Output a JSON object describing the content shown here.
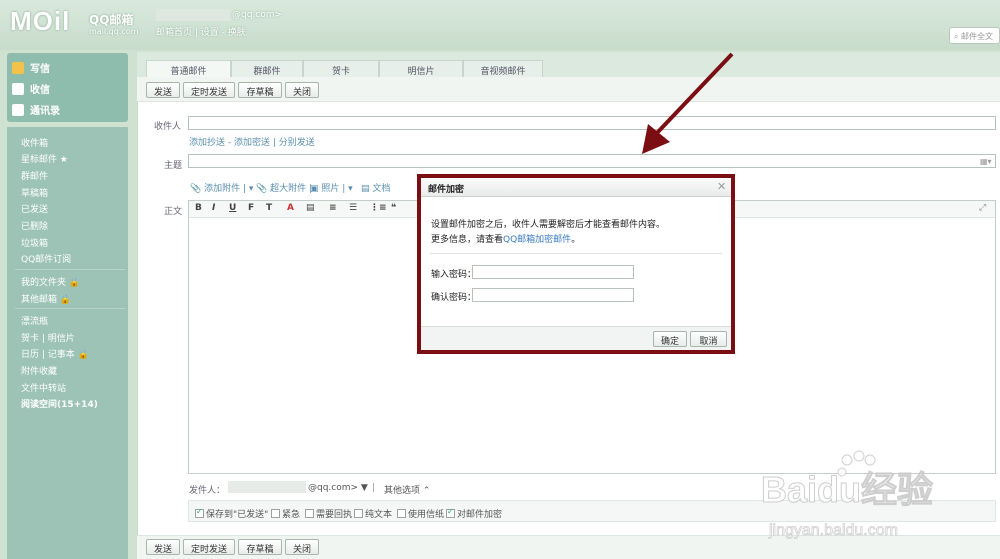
{
  "header": {
    "logo_mail": "MOil",
    "logo_brand": "QQ邮箱",
    "logo_url": "mail.qq.com",
    "account_domain": "@qq.com>",
    "links": "邮箱首页 | 设置 - 换肤",
    "search_placeholder": "邮件全文"
  },
  "sidebar": {
    "main": [
      {
        "label": "写信",
        "icon": "pencil-icon",
        "color": "#f3c24a"
      },
      {
        "label": "收信",
        "icon": "inbox-down-icon",
        "color": "#ffffff"
      },
      {
        "label": "通讯录",
        "icon": "contacts-icon",
        "color": "#ffffff"
      }
    ],
    "group1": [
      "收件箱",
      "星标邮件 ★",
      "群邮件",
      "草稿箱",
      "已发送",
      "已删除",
      "垃圾箱",
      "QQ邮件订阅"
    ],
    "group2": [
      "我的文件夹 🔒",
      "其他邮箱 🔒"
    ],
    "group3": [
      "漂流瓶",
      "贺卡 | 明信片",
      "日历 | 记事本 🔒",
      "附件收藏",
      "文件中转站",
      "阅读空间(15+14)"
    ]
  },
  "tabs": [
    "普通邮件",
    "群邮件",
    "贺卡",
    "明信片",
    "音视频邮件"
  ],
  "toolbar": {
    "send": "发送",
    "timed_send": "定时发送",
    "save_draft": "存草稿",
    "close": "关闭"
  },
  "compose": {
    "to_label": "收件人",
    "cc_links": "添加抄送 - 添加密送 | 分别发送",
    "subject_label": "主题",
    "attach_add": "添加附件",
    "attach_big": "超大附件",
    "attach_photo": "照片",
    "attach_doc": "文档",
    "body_label": "正文",
    "editor_tools": [
      "B",
      "I",
      "U",
      "F",
      "T",
      "A",
      "▤",
      "≡",
      "☰",
      "⋮≡",
      "❝"
    ],
    "sender_label": "发件人：",
    "sender_domain": "@qq.com> ▼",
    "other_options": "其他选项 ⌃"
  },
  "options": [
    {
      "label": "保存到\"已发送\"",
      "checked": true
    },
    {
      "label": "紧急",
      "checked": false
    },
    {
      "label": "需要回执",
      "checked": false
    },
    {
      "label": "纯文本",
      "checked": false
    },
    {
      "label": "使用信纸",
      "checked": false
    },
    {
      "label": "对邮件加密",
      "checked": true
    }
  ],
  "dialog": {
    "title": "邮件加密",
    "line1": "设置邮件加密之后，收件人需要解密后才能查看邮件内容。",
    "line2_prefix": "更多信息，请查看",
    "line2_link": "QQ邮箱加密邮件",
    "line2_suffix": "。",
    "pwd_label": "输入密码：",
    "confirm_label": "确认密码：",
    "ok": "确定",
    "cancel": "取消"
  },
  "watermark": {
    "brand": "Baidu经验",
    "url": "jingyan.baidu.com"
  },
  "colors": {
    "accent_red": "#7a0e12",
    "sidebar": "#9cc3b5",
    "link": "#5b8fb0"
  }
}
